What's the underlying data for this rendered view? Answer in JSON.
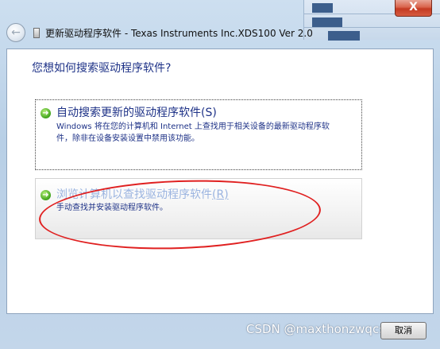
{
  "window": {
    "title": "更新驱动程序软件 - Texas Instruments Inc.XDS100 Ver 2.0",
    "close_glyph": "X",
    "back_glyph": "←"
  },
  "background_window": {
    "items": []
  },
  "main": {
    "heading": "您想如何搜索驱动程序软件?",
    "options": [
      {
        "title": "自动搜索更新的驱动程序软件",
        "hotkey": "(S)",
        "desc_line1": "Windows 将在您的计算机和 Internet 上查找用于相关设备的最新驱动程序软",
        "desc_line2": "件，除非在设备安装设置中禁用该功能。",
        "icon": "green-arrow-icon"
      },
      {
        "title": "浏览计算机以查找驱动程序软件",
        "hotkey": "(R)",
        "desc_line1": "手动查找并安装驱动程序软件。",
        "icon": "green-arrow-icon"
      }
    ]
  },
  "footer": {
    "cancel_label": "取消",
    "watermark": "CSDN @maxthonzwqcsdn"
  },
  "colors": {
    "link_blue": "#1e3287",
    "annotation_red": "#e02020",
    "close_red": "#c43a22"
  }
}
